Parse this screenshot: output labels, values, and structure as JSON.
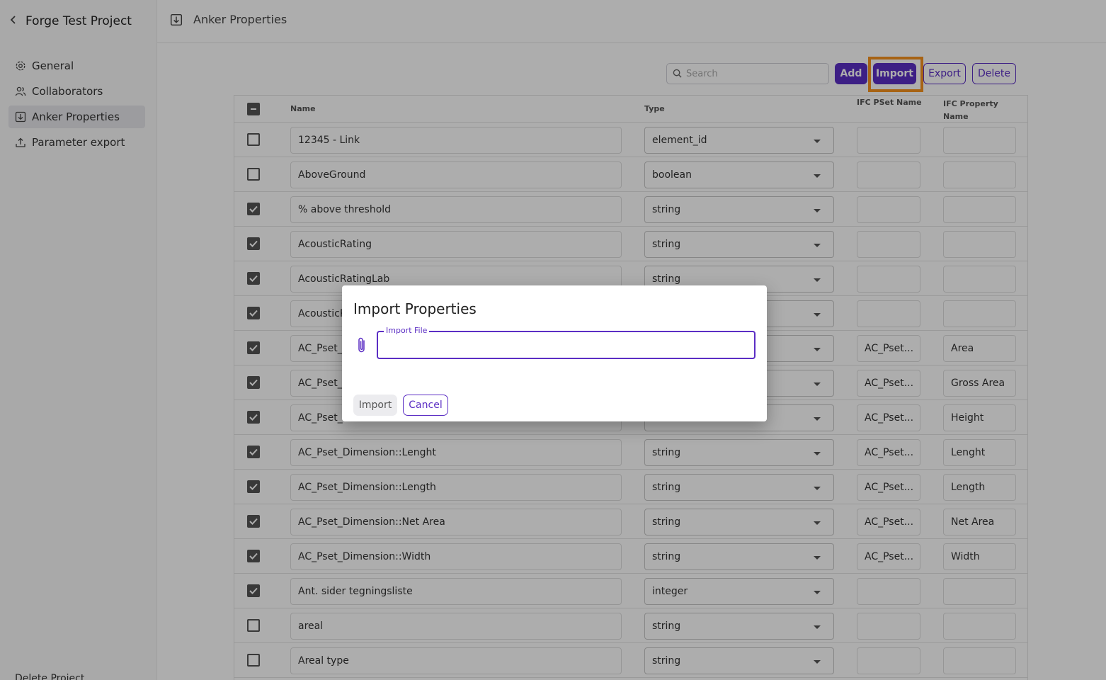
{
  "sidebar": {
    "project_title": "Forge Test Project",
    "items": [
      {
        "label": "General",
        "icon": "gear-icon"
      },
      {
        "label": "Collaborators",
        "icon": "users-icon"
      },
      {
        "label": "Anker Properties",
        "icon": "download-box-icon",
        "active": true
      },
      {
        "label": "Parameter export",
        "icon": "upload-icon"
      }
    ],
    "delete_label": "Delete Project"
  },
  "header": {
    "title": "Anker Properties",
    "icon": "download-box-icon"
  },
  "toolbar": {
    "search_placeholder": "Search",
    "add_label": "Add",
    "import_label": "Import",
    "export_label": "Export",
    "delete_label": "Delete"
  },
  "table": {
    "columns": [
      "Name",
      "Type",
      "IFC PSet Name",
      "IFC Property Name"
    ],
    "rows": [
      {
        "checked": false,
        "name": "12345 - Link",
        "type": "element_id",
        "pset": "",
        "prop": ""
      },
      {
        "checked": false,
        "name": "AboveGround",
        "type": "boolean",
        "pset": "",
        "prop": ""
      },
      {
        "checked": true,
        "name": "% above threshold",
        "type": "string",
        "pset": "",
        "prop": ""
      },
      {
        "checked": true,
        "name": "AcousticRating",
        "type": "string",
        "pset": "",
        "prop": ""
      },
      {
        "checked": true,
        "name": "AcousticRatingLab",
        "type": "string",
        "pset": "",
        "prop": ""
      },
      {
        "checked": true,
        "name": "AcousticR",
        "type": "",
        "pset": "",
        "prop": ""
      },
      {
        "checked": true,
        "name": "AC_Pset_",
        "type": "",
        "pset": "AC_Pset...",
        "prop": "Area"
      },
      {
        "checked": true,
        "name": "AC_Pset_",
        "type": "",
        "pset": "AC_Pset...",
        "prop": "Gross Area"
      },
      {
        "checked": true,
        "name": "AC_Pset_",
        "type": "",
        "pset": "AC_Pset...",
        "prop": "Height"
      },
      {
        "checked": true,
        "name": "AC_Pset_Dimension::Lenght",
        "type": "string",
        "pset": "AC_Pset...",
        "prop": "Lenght"
      },
      {
        "checked": true,
        "name": "AC_Pset_Dimension::Length",
        "type": "string",
        "pset": "AC_Pset...",
        "prop": "Length"
      },
      {
        "checked": true,
        "name": "AC_Pset_Dimension::Net Area",
        "type": "string",
        "pset": "AC_Pset...",
        "prop": "Net Area"
      },
      {
        "checked": true,
        "name": "AC_Pset_Dimension::Width",
        "type": "string",
        "pset": "AC_Pset...",
        "prop": "Width"
      },
      {
        "checked": true,
        "name": "Ant. sider tegningsliste",
        "type": "integer",
        "pset": "",
        "prop": ""
      },
      {
        "checked": false,
        "name": "areal",
        "type": "string",
        "pset": "",
        "prop": ""
      },
      {
        "checked": false,
        "name": "Areal type",
        "type": "string",
        "pset": "",
        "prop": ""
      }
    ]
  },
  "dialog": {
    "title": "Import Properties",
    "field_label": "Import File",
    "field_value": "",
    "import_label": "Import",
    "cancel_label": "Cancel",
    "icon": "paperclip-icon"
  },
  "colors": {
    "accent": "#5b2ec4",
    "highlight": "#f7931e"
  }
}
